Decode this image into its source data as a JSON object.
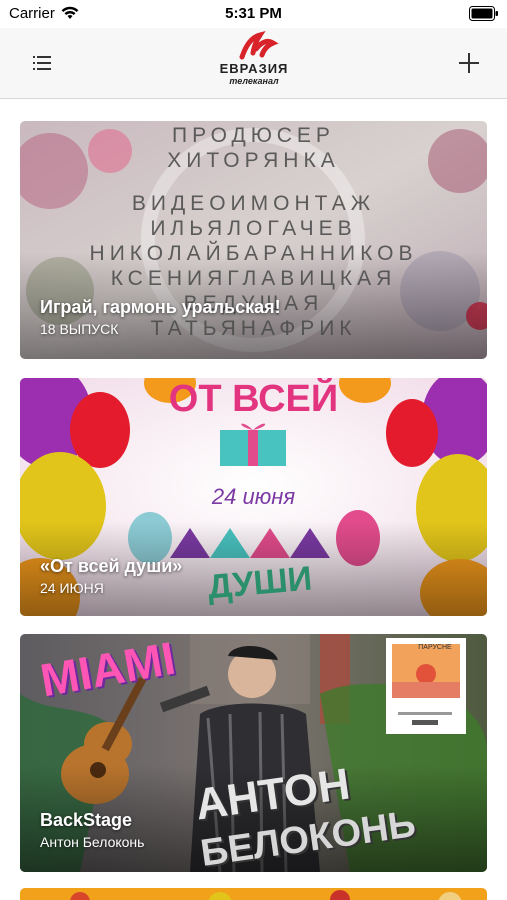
{
  "status_bar": {
    "carrier": "Carrier",
    "time": "5:31 PM"
  },
  "header": {
    "logo_name": "ЕВРАЗИЯ",
    "logo_sub": "телеканал",
    "menu_icon": "list-icon",
    "add_icon": "plus-icon"
  },
  "feed": [
    {
      "title": "Играй, гармонь уральская!",
      "subtitle": "18 ВЫПУСК",
      "poster_lines": [
        "ПРОДЮСЕР",
        "ХИТОРЯНКА",
        "",
        "ВИДЕОИМОНТАЖ",
        "ИЛЬЯЛОГАЧЕВ",
        "НИКОЛАЙБАРАННИКОВ",
        "КСЕНИЯГЛАВИЦКАЯ",
        "ВЕДУЩАЯ",
        "ТАТЬЯНАФРИК"
      ]
    },
    {
      "title": "«От всей души»",
      "subtitle": "24 ИЮНЯ",
      "poster_top": "ОТ ВСЕЙ",
      "poster_date": "24 июня",
      "poster_bottom": "ДУШИ"
    },
    {
      "title": "BackStage",
      "subtitle": "Антон Белоконь",
      "poster_miami": "MIAMI",
      "poster_name_1": "АНТОН",
      "poster_name_2": "БЕЛОКОНЬ",
      "album_title": "ПАРУСНЕ"
    }
  ],
  "colors": {
    "accent": "#d8232a",
    "card_text": "#ffffff",
    "nav_bg": "#f7f7f7"
  }
}
